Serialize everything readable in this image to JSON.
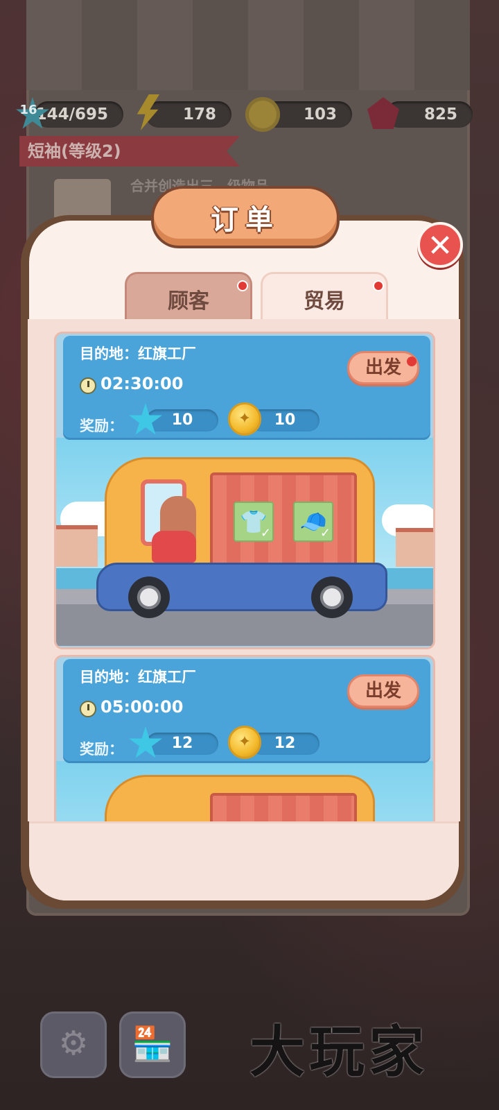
{
  "stats": {
    "level": "16",
    "xp": "144/695",
    "energy": "178",
    "coins": "103",
    "gems": "825"
  },
  "background": {
    "ribbon_title": "短袖(等级2)",
    "description": "合并创造出三…级物品"
  },
  "modal": {
    "title": "订单",
    "tabs": [
      {
        "label": "顾客",
        "has_dot": true
      },
      {
        "label": "贸易",
        "has_dot": true,
        "active": true
      }
    ],
    "orders": [
      {
        "destination": "目的地：红旗工厂",
        "time": "02:30:00",
        "reward_label": "奖励：",
        "reward_stars": "10",
        "reward_coins": "10",
        "depart_label": "出发",
        "depart_dot": true,
        "items": [
          "shirt-icon",
          "cap-icon"
        ]
      },
      {
        "destination": "目的地：红旗工厂",
        "time": "05:00:00",
        "reward_label": "奖励：",
        "reward_stars": "12",
        "reward_coins": "12",
        "depart_label": "出发",
        "depart_dot": false
      }
    ]
  },
  "watermark": "大玩家",
  "colors": {
    "card_header": "#4aa3d9",
    "title_plate": "#f3a878",
    "close_button": "#e8524f",
    "depart_button": "#f6b59b"
  }
}
